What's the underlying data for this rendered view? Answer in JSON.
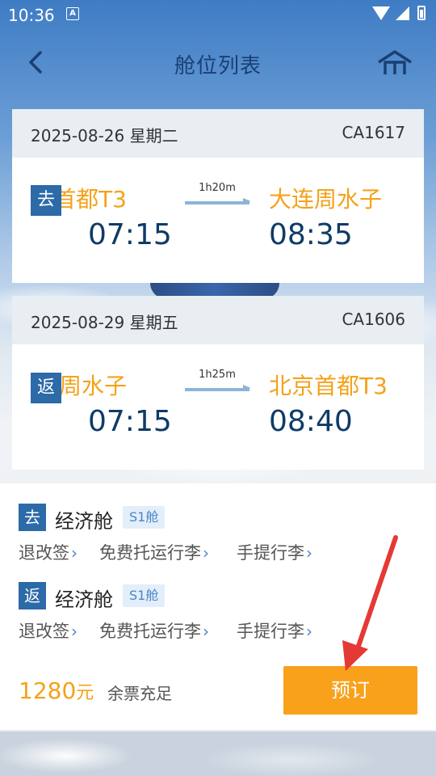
{
  "status_bar": {
    "time": "10:36",
    "app_icon": "A"
  },
  "header": {
    "title": "舱位列表"
  },
  "flights": [
    {
      "date": "2025-08-26 星期二",
      "flight_no": "CA1617",
      "direction": "去",
      "dep_city": "首都T3",
      "arr_city": "大连周水子",
      "duration": "1h20m",
      "dep_time": "07:15",
      "arr_time": "08:35"
    },
    {
      "date": "2025-08-29 星期五",
      "flight_no": "CA1606",
      "direction": "返",
      "dep_city": "周水子",
      "arr_city": "北京首都T3",
      "duration": "1h25m",
      "dep_time": "07:15",
      "arr_time": "08:40"
    }
  ],
  "segments": [
    {
      "tag": "去",
      "cabin": "经济舱",
      "class": "S1舱",
      "rules": [
        "退改签",
        "免费托运行李",
        "手提行李"
      ]
    },
    {
      "tag": "返",
      "cabin": "经济舱",
      "class": "S1舱",
      "rules": [
        "退改签",
        "免费托运行李",
        "手提行李"
      ]
    }
  ],
  "footer": {
    "price": "1280",
    "price_unit": "元",
    "ticket_status": "余票充足",
    "book_label": "预订"
  },
  "colors": {
    "accent": "#f9a11b",
    "primary": "#2c6aa8",
    "time": "#0f3b66",
    "city": "#f4a21a"
  },
  "icons": {
    "back": "chevron-left-icon",
    "home": "home-icon",
    "arrow": "red-annotation-arrow"
  }
}
